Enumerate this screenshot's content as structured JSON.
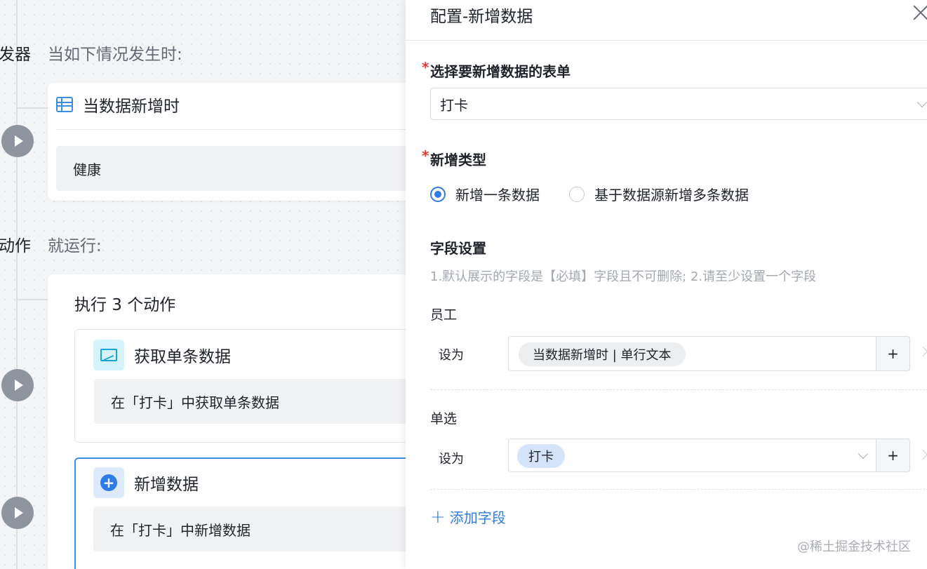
{
  "canvas": {
    "trigger_stage_label": "发器",
    "trigger_hint": "当如下情况发生时:",
    "trigger_card_title": "当数据新增时",
    "trigger_card_value": "健康",
    "action_stage_label": "动作",
    "action_hint": "就运行:",
    "actions_title": "执行 3 个动作",
    "actions": [
      {
        "title": "获取单条数据",
        "description": "在「打卡」中获取单条数据",
        "icon": "chart-icon"
      },
      {
        "title": "新增数据",
        "description": "在「打卡」中新增数据",
        "icon": "plus-circle-icon"
      }
    ]
  },
  "panel": {
    "title": "配置-新增数据",
    "form_label": "选择要新增数据的表单",
    "form_value": "打卡",
    "type_label": "新增类型",
    "type_options": [
      "新增一条数据",
      "基于数据源新增多条数据"
    ],
    "type_selected": "新增一条数据",
    "fields_section_title": "字段设置",
    "fields_hint": "1.默认展示的字段是【必填】字段且不可删除; 2.请至少设置一个字段",
    "fields": [
      {
        "name": "员工",
        "set_label": "设为",
        "value": "当数据新增时 | 单行文本",
        "add": "+"
      },
      {
        "name": "单选",
        "set_label": "设为",
        "value": "打卡",
        "add": "+"
      }
    ],
    "add_field_label": "添加字段",
    "required_mark": "*"
  },
  "watermark": "@稀土掘金技术社区",
  "colors": {
    "accent": "#2f7be8",
    "required": "#e53935",
    "hint": "#a3a8af"
  }
}
